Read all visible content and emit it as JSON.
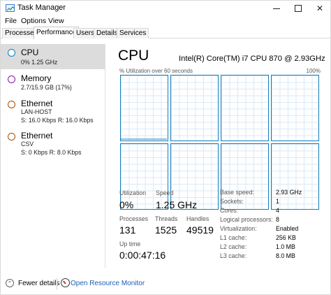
{
  "window": {
    "title": "Task Manager"
  },
  "menu": [
    "File",
    "Options",
    "View"
  ],
  "tabs": [
    {
      "label": "Processes",
      "active": false
    },
    {
      "label": "Performance",
      "active": true
    },
    {
      "label": "Users",
      "active": false
    },
    {
      "label": "Details",
      "active": false
    },
    {
      "label": "Services",
      "active": false
    }
  ],
  "sidebar": {
    "items": [
      {
        "title": "CPU",
        "line1": "0%  1.25 GHz",
        "line2": "",
        "ring_color": "#117dbb",
        "selected": true
      },
      {
        "title": "Memory",
        "line1": "2.7/15.9 GB (17%)",
        "line2": "",
        "ring_color": "#8b12ae",
        "selected": false
      },
      {
        "title": "Ethernet",
        "line1": "LAN-HOST",
        "line2": "S: 16.0 Kbps  R: 16.0 Kbps",
        "ring_color": "#a74f01",
        "selected": false
      },
      {
        "title": "Ethernet",
        "line1": "CSV",
        "line2": "S: 0 Kbps  R: 8.0 Kbps",
        "ring_color": "#a74f01",
        "selected": false
      }
    ]
  },
  "main": {
    "title": "CPU",
    "model": "Intel(R) Core(TM) i7 CPU 870 @ 2.93GHz",
    "util_label": "% Utilization over 60 seconds",
    "util_max": "100%",
    "graph_count": 8,
    "graph_color": "#117dbb"
  },
  "stats": {
    "utilization_label": "Utilization",
    "utilization": "0%",
    "speed_label": "Speed",
    "speed": "1.25 GHz",
    "processes_label": "Processes",
    "processes": "131",
    "threads_label": "Threads",
    "threads": "1525",
    "handles_label": "Handles",
    "handles": "49519",
    "uptime_label": "Up time",
    "uptime": "0:00:47:16"
  },
  "specs": [
    {
      "key": "Base speed:",
      "value": "2.93 GHz"
    },
    {
      "key": "Sockets:",
      "value": "1"
    },
    {
      "key": "Cores:",
      "value": "4"
    },
    {
      "key": "Logical processors:",
      "value": "8"
    },
    {
      "key": "Virtualization:",
      "value": "Enabled"
    },
    {
      "key": "L1 cache:",
      "value": "256 KB"
    },
    {
      "key": "L2 cache:",
      "value": "1.0 MB"
    },
    {
      "key": "L3 cache:",
      "value": "8.0 MB"
    }
  ],
  "footer": {
    "fewer_details": "Fewer details",
    "open_resource_monitor": "Open Resource Monitor"
  }
}
